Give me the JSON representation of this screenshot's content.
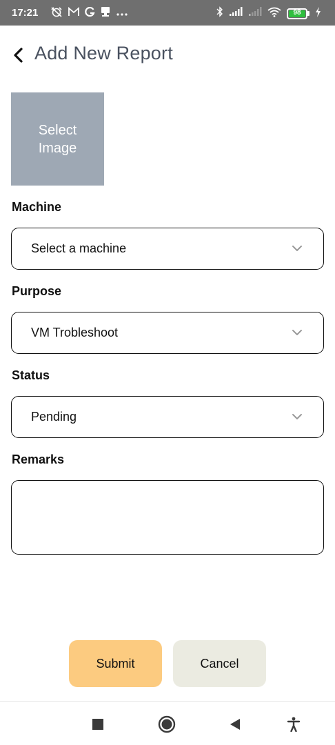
{
  "status_bar": {
    "time": "17:21",
    "left_icons": [
      "alarm-off-icon",
      "gmail-icon",
      "google-icon",
      "notification-icon",
      "more-icon"
    ],
    "right_icons": [
      "bluetooth-icon",
      "signal-icon",
      "signal-weak-icon",
      "wifi-icon",
      "battery-icon",
      "charging-icon"
    ],
    "battery_level": "98",
    "battery_color": "#2fbf3e"
  },
  "header": {
    "title": "Add New Report",
    "back_icon": "chevron-left-icon"
  },
  "image_picker": {
    "label": "Select Image",
    "background": "#9ea8b4"
  },
  "form": {
    "machine": {
      "label": "Machine",
      "value": "Select a machine"
    },
    "purpose": {
      "label": "Purpose",
      "value": "VM Trobleshoot"
    },
    "status": {
      "label": "Status",
      "value": "Pending"
    },
    "remarks": {
      "label": "Remarks",
      "value": ""
    }
  },
  "actions": {
    "submit_label": "Submit",
    "cancel_label": "Cancel",
    "submit_color": "#fccb80",
    "cancel_color": "#ebebe1"
  },
  "nav_bar": {
    "icons": [
      "recents-square-icon",
      "home-circle-icon",
      "back-triangle-icon",
      "accessibility-icon"
    ]
  }
}
